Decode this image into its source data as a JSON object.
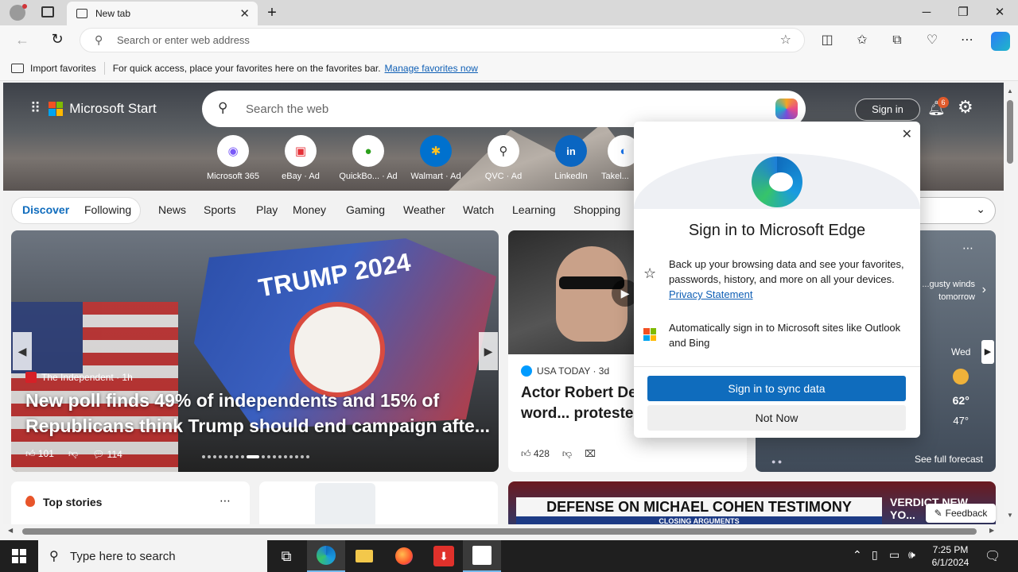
{
  "tab": {
    "title": "New tab"
  },
  "address": {
    "placeholder": "Search or enter web address"
  },
  "favbar": {
    "import_label": "Import favorites",
    "hint": "For quick access, place your favorites here on the favorites bar.",
    "manage_link": "Manage favorites now"
  },
  "start": {
    "brand": "Microsoft Start",
    "search_placeholder": "Search the web",
    "signin": "Sign in",
    "notif_count": "6",
    "quicklinks": [
      "Microsoft 365",
      "eBay · Ad",
      "QuickBo... · Ad",
      "Walmart · Ad",
      "QVC · Ad",
      "LinkedIn",
      "Takel..."
    ]
  },
  "nav": {
    "discover": "Discover",
    "following": "Following",
    "items": [
      "News",
      "Sports",
      "Play",
      "Money",
      "Gaming",
      "Weather",
      "Watch",
      "Learning",
      "Shopping"
    ]
  },
  "main_story": {
    "source": "The Independent · 1h",
    "title": "New poll finds 49% of independents and 15% of Republicans think Trump should end campaign afte...",
    "likes": "101",
    "comments": "114",
    "flag_text": "TRUMP 2024"
  },
  "second_story": {
    "source": "USA TODAY · 3d",
    "title": "Actor Robert De... exchanges word... protester after sp...",
    "likes": "428"
  },
  "weather": {
    "text": "...gusty winds tomorrow",
    "day": "Wed",
    "high": "62°",
    "low": "47°",
    "full_forecast": "See full forecast"
  },
  "bottom": {
    "top_stories": "Top stories",
    "news_headline": "DEFENSE ON MICHAEL COHEN TESTIMONY",
    "news_sub": "CLOSING ARGUMENTS",
    "news_right": "VERDICT NEW YO...",
    "feedback": "Feedback"
  },
  "popup": {
    "title": "Sign in to Microsoft Edge",
    "row1": "Back up your browsing data and see your favorites, passwords, history, and more on all your devices.",
    "privacy": "Privacy Statement",
    "row2": "Automatically sign in to Microsoft sites like Outlook and Bing",
    "sync_button": "Sign in to sync data",
    "notnow_button": "Not Now"
  },
  "taskbar": {
    "search_placeholder": "Type here to search",
    "time": "7:25 PM",
    "date": "6/1/2024"
  }
}
